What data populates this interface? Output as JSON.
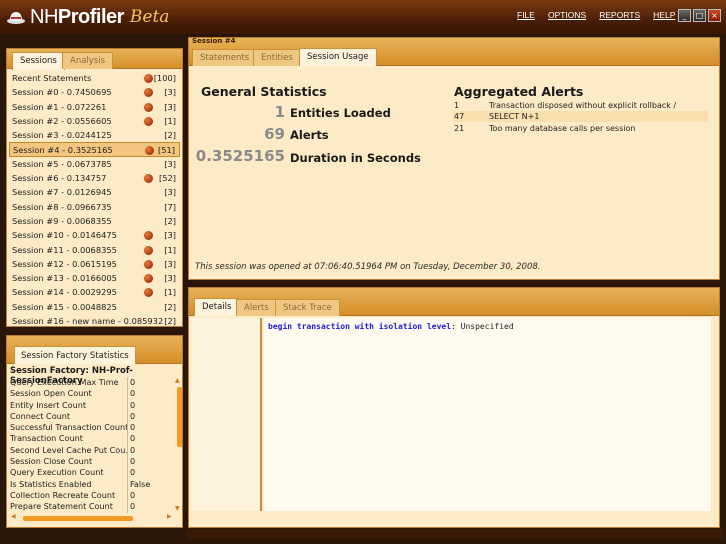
{
  "app": {
    "title_nh": "NH",
    "title_profiler": "Profiler",
    "title_beta": "Beta",
    "menu": [
      "FILE",
      "OPTIONS",
      "REPORTS",
      "HELP"
    ],
    "window_buttons": [
      "_",
      "□",
      "×"
    ]
  },
  "left_tabs": [
    "Sessions",
    "Analysis"
  ],
  "sessions": [
    {
      "label": "Recent Statements",
      "dot": true,
      "count": "[100]",
      "selected": false
    },
    {
      "label": "Session #0  - 0.7450695",
      "dot": true,
      "count": "[3]",
      "selected": false
    },
    {
      "label": "Session #1  - 0.072261",
      "dot": true,
      "count": "[3]",
      "selected": false
    },
    {
      "label": "Session #2  - 0.0556605",
      "dot": true,
      "count": "[1]",
      "selected": false
    },
    {
      "label": "Session #3  - 0.0244125",
      "dot": false,
      "count": "[2]",
      "selected": false
    },
    {
      "label": "Session #4  - 0.3525165",
      "dot": true,
      "count": "[51]",
      "selected": true
    },
    {
      "label": "Session #5  - 0.0673785",
      "dot": false,
      "count": "[3]",
      "selected": false
    },
    {
      "label": "Session #6  - 0.134757",
      "dot": true,
      "count": "[52]",
      "selected": false
    },
    {
      "label": "Session #7  - 0.0126945",
      "dot": false,
      "count": "[3]",
      "selected": false
    },
    {
      "label": "Session #8  - 0.0966735",
      "dot": false,
      "count": "[7]",
      "selected": false
    },
    {
      "label": "Session #9  - 0.0068355",
      "dot": false,
      "count": "[2]",
      "selected": false
    },
    {
      "label": "Session #10  - 0.0146475",
      "dot": true,
      "count": "[3]",
      "selected": false
    },
    {
      "label": "Session #11  - 0.0068355",
      "dot": true,
      "count": "[1]",
      "selected": false
    },
    {
      "label": "Session #12  - 0.0615195",
      "dot": true,
      "count": "[3]",
      "selected": false
    },
    {
      "label": "Session #13  - 0.0166005",
      "dot": true,
      "count": "[3]",
      "selected": false
    },
    {
      "label": "Session #14  - 0.0029295",
      "dot": true,
      "count": "[1]",
      "selected": false
    },
    {
      "label": "Session #15  - 0.0048825",
      "dot": false,
      "count": "[2]",
      "selected": false
    },
    {
      "label": "Session #16 - new name  - 0.085932",
      "dot": false,
      "count": "[2]",
      "selected": false
    }
  ],
  "session_factory": {
    "tab_label": "Session Factory Statistics",
    "title": "Session Factory: NH-Prof-SessionFactory",
    "rows": [
      {
        "key": "Query Execution Max Time",
        "value": "0"
      },
      {
        "key": "Session Open Count",
        "value": "0"
      },
      {
        "key": "Entity Insert Count",
        "value": "0"
      },
      {
        "key": "Connect Count",
        "value": "0"
      },
      {
        "key": "Successful Transaction Count",
        "value": "0"
      },
      {
        "key": "Transaction Count",
        "value": "0"
      },
      {
        "key": "Second Level Cache Put Cou...",
        "value": "0"
      },
      {
        "key": "Session Close Count",
        "value": "0"
      },
      {
        "key": "Query Execution Count",
        "value": "0"
      },
      {
        "key": "Is Statistics Enabled",
        "value": "False"
      },
      {
        "key": "Collection Recreate Count",
        "value": "0"
      },
      {
        "key": "Prepare Statement Count",
        "value": "0"
      }
    ]
  },
  "session_pane": {
    "label": "Session #4",
    "tabs": [
      "Statements",
      "Entities",
      "Session Usage"
    ],
    "general_title": "General Statistics",
    "stats": [
      {
        "num": "1",
        "label": "Entities Loaded"
      },
      {
        "num": "69",
        "label": "Alerts"
      },
      {
        "num": "0.3525165",
        "label": "Duration in Seconds"
      }
    ],
    "alerts_title": "Aggregated Alerts",
    "alerts": [
      {
        "count": "1",
        "text": "Transaction disposed without explicit rollback / commit"
      },
      {
        "count": "47",
        "text": "SELECT N+1"
      },
      {
        "count": "21",
        "text": "Too many database calls per session"
      }
    ],
    "opened": "This session was opened at 07:06:40.51964 PM on Tuesday, December 30, 2008."
  },
  "detail_pane": {
    "tabs": [
      "Details",
      "Alerts",
      "Stack Trace"
    ],
    "code_keyword": "begin transaction with isolation level",
    "code_text": ": Unspecified"
  }
}
